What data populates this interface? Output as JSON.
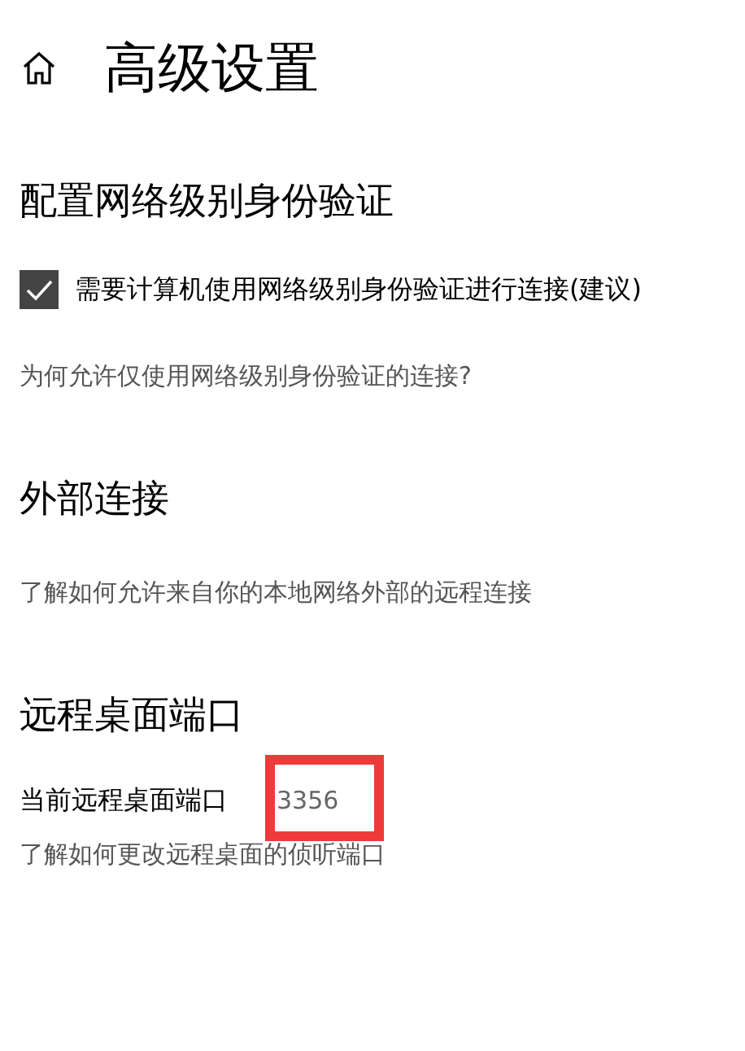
{
  "page": {
    "title": "高级设置"
  },
  "sections": [
    {
      "heading": "配置网络级别身份验证",
      "checkbox": {
        "label": "需要计算机使用网络级别身份验证进行连接(建议)",
        "checked": true
      },
      "link": "为何允许仅使用网络级别身份验证的连接?"
    },
    {
      "heading": "外部连接",
      "link": "了解如何允许来自你的本地网络外部的远程连接"
    },
    {
      "heading": "远程桌面端口",
      "port": {
        "label": "当前远程桌面端口",
        "value": "3356",
        "highlighted": true
      },
      "link": "了解如何更改远程桌面的侦听端口"
    }
  ]
}
